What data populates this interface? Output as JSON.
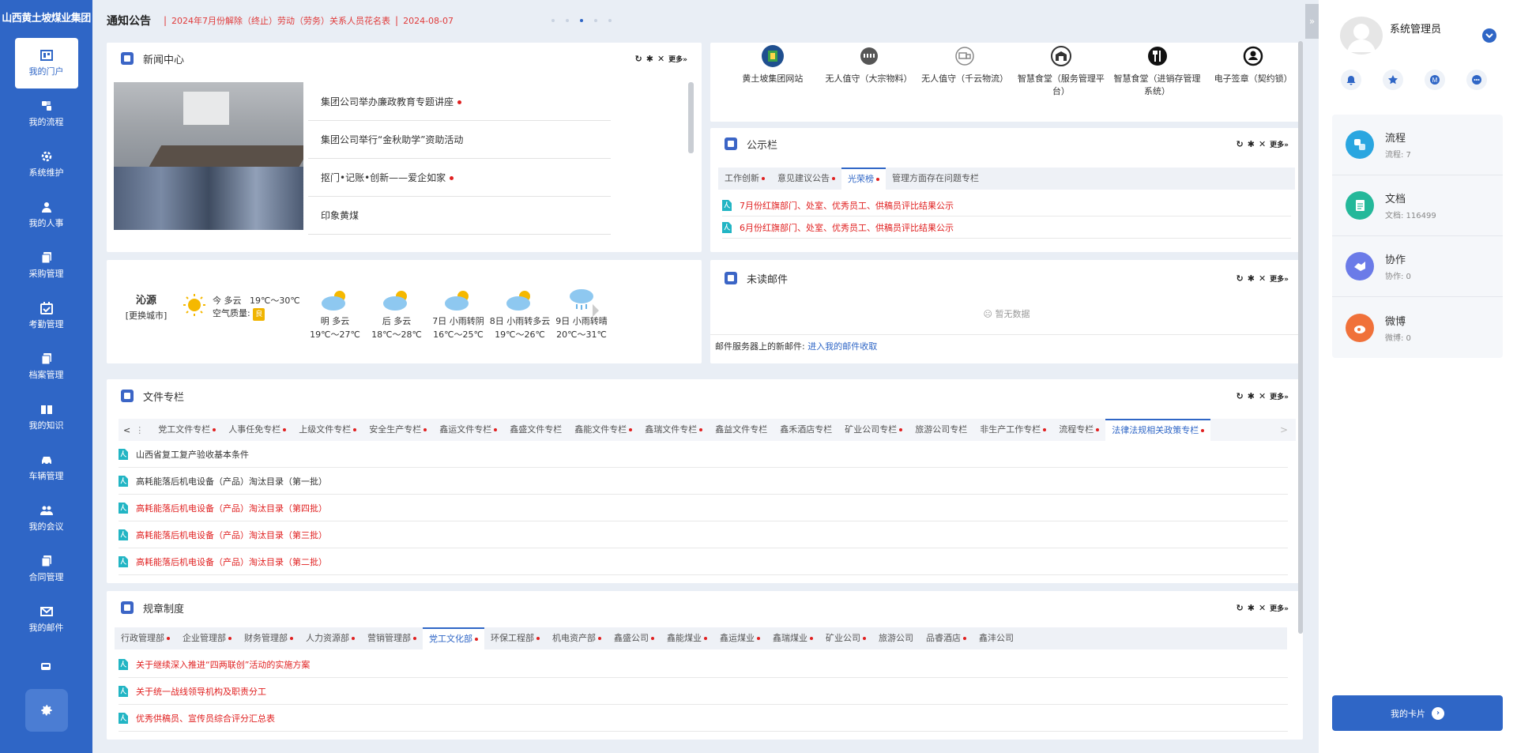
{
  "brand": "山西黄土坡煤业集团",
  "nav": [
    {
      "label": "我的门户",
      "icon": "portal-icon"
    },
    {
      "label": "我的流程",
      "icon": "flow-icon"
    },
    {
      "label": "系统维护",
      "icon": "gear-icon"
    },
    {
      "label": "我的人事",
      "icon": "person-icon"
    },
    {
      "label": "采购管理",
      "icon": "copy-icon"
    },
    {
      "label": "考勤管理",
      "icon": "calendar-check-icon"
    },
    {
      "label": "档案管理",
      "icon": "copy-icon"
    },
    {
      "label": "我的知识",
      "icon": "book-icon"
    },
    {
      "label": "车辆管理",
      "icon": "car-icon"
    },
    {
      "label": "我的会议",
      "icon": "people-icon"
    },
    {
      "label": "合同管理",
      "icon": "copy-icon"
    },
    {
      "label": "我的邮件",
      "icon": "mail-icon"
    }
  ],
  "notice": {
    "title": "通知公告",
    "text": "2024年7月份解除（终止）劳动（劳务）关系人员花名表",
    "sep": "|",
    "date": "2024-08-07"
  },
  "news": {
    "title": "新闻中心",
    "tools": {
      "refresh": "↻",
      "settings": "✱",
      "close": "✕",
      "more": "更多»"
    },
    "items": [
      {
        "text": "集团公司举办廉政教育专题讲座"
      },
      {
        "text": "集团公司举行“金秋助学”资助活动"
      },
      {
        "text": "抠门•记账•创新——爱企如家"
      },
      {
        "text": "印象黄煤"
      }
    ]
  },
  "quick": [
    {
      "label": "黄土坡集团网站",
      "icon": "globe-icon",
      "color": "#1f4f8f"
    },
    {
      "label": "无人值守（大宗物料）",
      "icon": "barrier-icon",
      "color": "#555555"
    },
    {
      "label": "无人值守（千云物流）",
      "icon": "truck-icon",
      "color": "#888888"
    },
    {
      "label": "智慧食堂（服务管理平台）",
      "icon": "canteen-icon",
      "color": "#333333"
    },
    {
      "label": "智慧食堂（进销存管理系统）",
      "icon": "fork-knife-icon",
      "color": "#111111"
    },
    {
      "label": "电子签章（契约锁）",
      "icon": "seal-icon",
      "color": "#111111"
    }
  ],
  "bulletin": {
    "title": "公示栏",
    "tabs": [
      {
        "label": "工作创新",
        "dot": true
      },
      {
        "label": "意见建议公告",
        "dot": true
      },
      {
        "label": "光荣榜",
        "dot": true,
        "active": true
      },
      {
        "label": "管理方面存在问题专栏",
        "dot": false
      }
    ],
    "items": [
      {
        "text": "7月份红旗部门、处室、优秀员工、供稿员评比结果公示"
      },
      {
        "text": "6月份红旗部门、处室、优秀员工、供稿员评比结果公示"
      }
    ]
  },
  "weather": {
    "city": "沁源",
    "switch": "[更换城市]",
    "today": {
      "cond": "今 多云",
      "temp": "19℃～30℃",
      "aq_label": "空气质量:",
      "aq": "良"
    },
    "days": [
      {
        "name": "明",
        "cond": "多云",
        "temp": "19℃～27℃",
        "icon": "cloud-sun-icon"
      },
      {
        "name": "后",
        "cond": "多云",
        "temp": "18℃～28℃",
        "icon": "cloud-sun-icon"
      },
      {
        "name": "7日",
        "cond": "小雨转阴",
        "temp": "16℃～25℃",
        "icon": "cloud-sun-icon"
      },
      {
        "name": "8日",
        "cond": "小雨转多云",
        "temp": "19℃～26℃",
        "icon": "cloud-sun-icon"
      },
      {
        "name": "9日",
        "cond": "小雨转晴",
        "temp": "20℃～31℃",
        "icon": "rain-icon"
      }
    ]
  },
  "mail": {
    "title": "未读邮件",
    "empty": "暂无数据",
    "footer_label": "邮件服务器上的新邮件:",
    "footer_link": "进入我的邮件收取"
  },
  "files": {
    "title": "文件专栏",
    "tabs": [
      {
        "label": "党工文件专栏",
        "dot": true
      },
      {
        "label": "人事任免专栏",
        "dot": true
      },
      {
        "label": "上级文件专栏",
        "dot": true
      },
      {
        "label": "安全生产专栏",
        "dot": true
      },
      {
        "label": "鑫运文件专栏",
        "dot": true
      },
      {
        "label": "鑫盛文件专栏",
        "dot": false
      },
      {
        "label": "鑫能文件专栏",
        "dot": true
      },
      {
        "label": "鑫瑞文件专栏",
        "dot": true
      },
      {
        "label": "鑫益文件专栏",
        "dot": false
      },
      {
        "label": "鑫禾酒店专栏",
        "dot": false
      },
      {
        "label": "矿业公司专栏",
        "dot": true
      },
      {
        "label": "旅游公司专栏",
        "dot": false
      },
      {
        "label": "非生产工作专栏",
        "dot": true
      },
      {
        "label": "流程专栏",
        "dot": true
      },
      {
        "label": "法律法规相关政策专栏",
        "dot": true,
        "active": true
      }
    ],
    "items": [
      {
        "text": "山西省复工复产验收基本条件",
        "red": false
      },
      {
        "text": "高耗能落后机电设备（产品）淘汰目录（第一批）",
        "red": false
      },
      {
        "text": "高耗能落后机电设备（产品）淘汰目录（第四批）",
        "red": true
      },
      {
        "text": "高耗能落后机电设备（产品）淘汰目录（第三批）",
        "red": true
      },
      {
        "text": "高耗能落后机电设备（产品）淘汰目录（第二批）",
        "red": true
      }
    ]
  },
  "rules": {
    "title": "规章制度",
    "tabs": [
      {
        "label": "行政管理部",
        "dot": true
      },
      {
        "label": "企业管理部",
        "dot": true
      },
      {
        "label": "财务管理部",
        "dot": true
      },
      {
        "label": "人力资源部",
        "dot": true
      },
      {
        "label": "营销管理部",
        "dot": true
      },
      {
        "label": "党工文化部",
        "dot": true,
        "active": true
      },
      {
        "label": "环保工程部",
        "dot": true
      },
      {
        "label": "机电资产部",
        "dot": true
      },
      {
        "label": "鑫盛公司",
        "dot": true
      },
      {
        "label": "鑫能煤业",
        "dot": true
      },
      {
        "label": "鑫运煤业",
        "dot": true
      },
      {
        "label": "鑫瑞煤业",
        "dot": true
      },
      {
        "label": "矿业公司",
        "dot": true
      },
      {
        "label": "旅游公司",
        "dot": false
      },
      {
        "label": "品睿酒店",
        "dot": true
      },
      {
        "label": "鑫沣公司",
        "dot": false
      }
    ],
    "items": [
      {
        "text": "关于继续深入推进“四两联创”活动的实施方案"
      },
      {
        "text": "关于统一战线领导机构及职责分工"
      },
      {
        "text": "优秀供稿员、宣传员综合评分汇总表"
      }
    ]
  },
  "user": {
    "name": "系统管理员"
  },
  "user_actions": [
    {
      "icon": "bell-icon"
    },
    {
      "icon": "star-icon"
    },
    {
      "icon": "m-icon",
      "text": "M"
    },
    {
      "icon": "more-dots-icon"
    }
  ],
  "stats": [
    {
      "title": "流程",
      "sub": "流程: 7",
      "color": "#2aa6e0",
      "icon": "flow-icon"
    },
    {
      "title": "文档",
      "sub": "文档: 116499",
      "color": "#24b89a",
      "icon": "document-icon"
    },
    {
      "title": "协作",
      "sub": "协作: 0",
      "color": "#6b7be8",
      "icon": "handshake-icon"
    },
    {
      "title": "微博",
      "sub": "微博: 0",
      "color": "#f0713a",
      "icon": "weibo-icon"
    }
  ],
  "my_card": "我的卡片",
  "colors": {
    "primary": "#2f66c6",
    "alert": "#e02020",
    "page_bg": "#e9eef5"
  }
}
